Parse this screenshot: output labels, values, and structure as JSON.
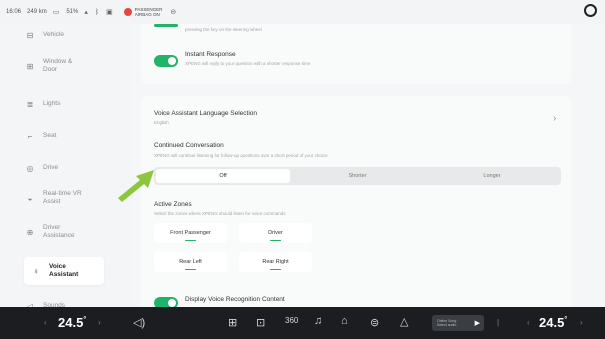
{
  "status": {
    "time": "16:06",
    "range": "249 km",
    "battery": "51%",
    "passenger_airbag_line1": "PASSENGER",
    "passenger_airbag_line2": "AIRBAG ON"
  },
  "sidebar": {
    "items": [
      {
        "label": "Vehicle",
        "icon": "car-icon"
      },
      {
        "label": "Window & Door",
        "icon": "window-icon"
      },
      {
        "label": "Lights",
        "icon": "lights-icon"
      },
      {
        "label": "Seat",
        "icon": "seat-icon"
      },
      {
        "label": "Drive",
        "icon": "steering-wheel-icon"
      },
      {
        "label": "Real-time VR Assist",
        "icon": "vr-icon"
      },
      {
        "label": "Driver Assistance",
        "icon": "driver-assist-icon"
      },
      {
        "label": "Voice Assistant",
        "icon": "voice-assistant-icon",
        "active": true
      },
      {
        "label": "Sounds",
        "icon": "speaker-icon"
      }
    ]
  },
  "main": {
    "top_desc": "pressing the key on the steering wheel",
    "instant_response": {
      "title": "Instant Response",
      "desc": "XPENG will reply to your question with a shorter response time",
      "enabled": true
    },
    "language": {
      "title": "Voice Assistant Language Selection",
      "value": "English"
    },
    "continued": {
      "title": "Continued Conversation",
      "desc": "XPENG will continue listening for follow-up questions over a short period of your choice",
      "options": [
        "Off",
        "Shorter",
        "Longer"
      ],
      "selected": "Off"
    },
    "zones": {
      "title": "Active Zones",
      "desc": "Select the zones where XPENG should listen for voice commands",
      "buttons": [
        "Front Passenger",
        "Driver",
        "Rear Left",
        "Rear Right"
      ]
    },
    "display_voice": {
      "title": "Display Voice Recognition Content",
      "enabled": true
    }
  },
  "bottom": {
    "left_temp": "24.5",
    "right_temp": "24.5",
    "degree": "°",
    "media_line1": "Online Song",
    "media_line2": "Select audio"
  },
  "colors": {
    "accent_green": "#20b46b",
    "arrow_green": "#8cc63f",
    "bottom_bar": "#1b1d20"
  }
}
